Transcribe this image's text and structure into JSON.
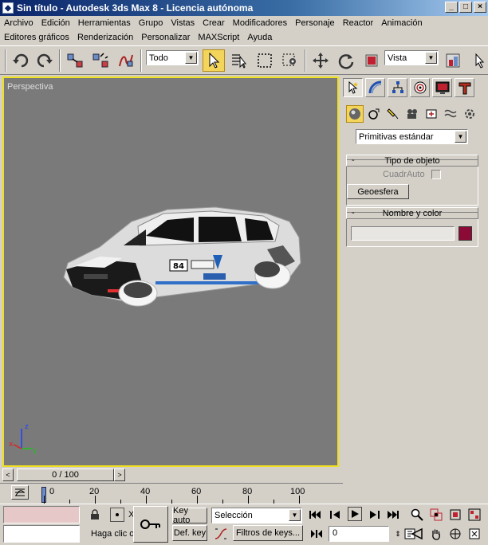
{
  "window": {
    "title": "Sin título - Autodesk 3ds Max 8 - Licencia autónoma",
    "icon": "3ds-max-icon"
  },
  "menus": {
    "row1": [
      "Archivo",
      "Edición",
      "Herramientas",
      "Grupo",
      "Vistas",
      "Crear",
      "Modificadores",
      "Personaje",
      "Reactor",
      "Animación"
    ],
    "row2": [
      "Editores gráficos",
      "Renderización",
      "Personalizar",
      "MAXScript",
      "Ayuda"
    ]
  },
  "toolbar": {
    "selection_filter": "Todo",
    "reference_coord": "Vista"
  },
  "viewport": {
    "label": "Perspectiva",
    "background": "#7a7a7a",
    "active_border": "#f0e020",
    "axis": {
      "x": "x",
      "y": "y",
      "z": "z"
    }
  },
  "command_panel": {
    "category": "Primitivas estándar",
    "rollout_object_type": {
      "title": "Tipo de objeto",
      "autogrid_label": "CuadrAuto",
      "button": "Geoesfera"
    },
    "rollout_name_color": {
      "title": "Nombre y color",
      "name_value": "",
      "color": "#8c0a36"
    }
  },
  "timeline": {
    "frame_display": "0 / 100",
    "ticks": [
      "0",
      "20",
      "40",
      "60",
      "80",
      "100"
    ]
  },
  "status": {
    "prompt": "Haga clic o",
    "x_label": "X",
    "key_auto": "Key auto",
    "def_key": "Def. key",
    "selection_mode": "Selección",
    "key_filters": "Filtros de keys...",
    "current_frame": "0"
  }
}
